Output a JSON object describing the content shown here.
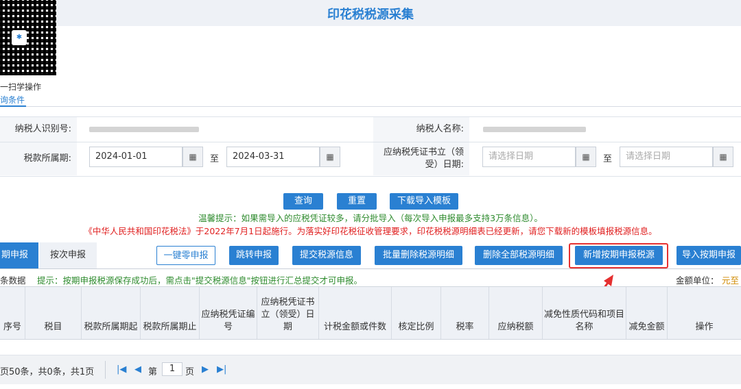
{
  "header": {
    "title": "印花税税源采集"
  },
  "scan": {
    "label": "一扫学操作",
    "condition": "询条件"
  },
  "form": {
    "taxpayer_id_label": "纳税人识别号:",
    "taxpayer_name_label": "纳税人名称:",
    "period_label": "税款所属期:",
    "period_start": "2024-01-01",
    "period_end": "2024-03-31",
    "to_label": "至",
    "voucher_date_label_1": "应纳税凭证书立（领",
    "voucher_date_label_2": "受）日期:",
    "date_placeholder": "请选择日期"
  },
  "actions": {
    "query": "查询",
    "reset": "重置",
    "download_template": "下载导入模板"
  },
  "tips": {
    "tip1": "温馨提示：如果需导入的应税凭证较多，请分批导入（每次导入申报最多支持3万条信息）。",
    "tip2": "《中华人民共和国印花税法》于2022年7月1日起施行。为落实好印花税征收管理要求，印花税税源明细表已经更新，请您下载新的模板填报税源信息。"
  },
  "tabs": {
    "active": "期申报",
    "other": "按次申报"
  },
  "toolbar": {
    "zero_declare": "一键零申报",
    "jump_declare": "跳转申报",
    "submit_info": "提交税源信息",
    "batch_delete": "批量删除税源明细",
    "delete_all": "删除全部税源明细",
    "add_period": "新增按期申报税源",
    "import_period": "导入按期申报"
  },
  "info": {
    "count_label": "条数据",
    "hint": "提示：按期申报税源保存成功后，需点击\"提交税源信息\"按钮进行汇总提交才可申报。",
    "unit_label": "金额单位：",
    "unit_value": "元至"
  },
  "table": {
    "headers": [
      "序号",
      "税目",
      "税款所属期起",
      "税款所属期止",
      "应纳税凭证编号",
      "应纳税凭证书立（领受）日期",
      "计税金额或件数",
      "核定比例",
      "税率",
      "应纳税额",
      "减免性质代码和项目名称",
      "减免金额",
      "操作"
    ]
  },
  "pager": {
    "summary": "页50条，共0条，共1页",
    "page_label_pre": "第",
    "page_value": "1",
    "page_label_post": "页"
  }
}
